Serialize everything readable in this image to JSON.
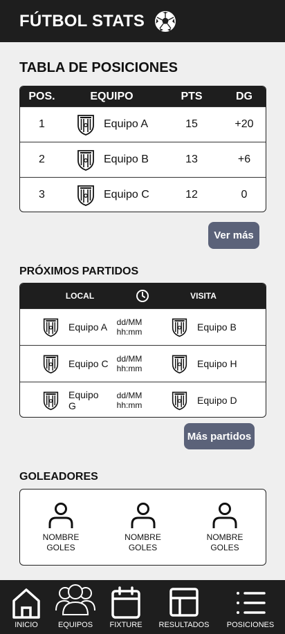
{
  "app": {
    "title": "FÚTBOL STATS"
  },
  "standings": {
    "title": "TABLA DE POSICIONES",
    "headers": {
      "pos": "POS.",
      "team": "EQUIPO",
      "pts": "PTS",
      "dg": "DG"
    },
    "rows": [
      {
        "pos": "1",
        "team": "Equipo A",
        "pts": "15",
        "dg": "+20"
      },
      {
        "pos": "2",
        "team": "Equipo B",
        "pts": "13",
        "dg": "+6"
      },
      {
        "pos": "3",
        "team": "Equipo C",
        "pts": "12",
        "dg": "0"
      }
    ],
    "more_label": "Ver más"
  },
  "matches": {
    "title": "PRÓXIMOS PARTIDOS",
    "headers": {
      "local": "LOCAL",
      "visita": "VISITA"
    },
    "rows": [
      {
        "home": "Equipo A",
        "date": "dd/MM",
        "time": "hh:mm",
        "away": "Equipo B"
      },
      {
        "home": "Equipo C",
        "date": "dd/MM",
        "time": "hh:mm",
        "away": "Equipo H"
      },
      {
        "home": "Equipo G",
        "date": "dd/MM",
        "time": "hh:mm",
        "away": "Equipo D"
      }
    ],
    "more_label": "Más partidos"
  },
  "scorers": {
    "title": "GOLEADORES",
    "items": [
      {
        "name": "NOMBRE",
        "goals": "GOLES"
      },
      {
        "name": "NOMBRE",
        "goals": "GOLES"
      },
      {
        "name": "NOMBRE",
        "goals": "GOLES"
      }
    ]
  },
  "nav": {
    "items": [
      {
        "label": "INICIO",
        "icon": "home-icon"
      },
      {
        "label": "EQUIPOS",
        "icon": "users-icon"
      },
      {
        "label": "FIXTURE",
        "icon": "calendar-icon"
      },
      {
        "label": "RESULTADOS",
        "icon": "grid-icon"
      },
      {
        "label": "POSICIONES",
        "icon": "list-icon"
      }
    ]
  },
  "colors": {
    "dark": "#1e1e1e",
    "button": "#5b6279",
    "background": "#efefef"
  }
}
